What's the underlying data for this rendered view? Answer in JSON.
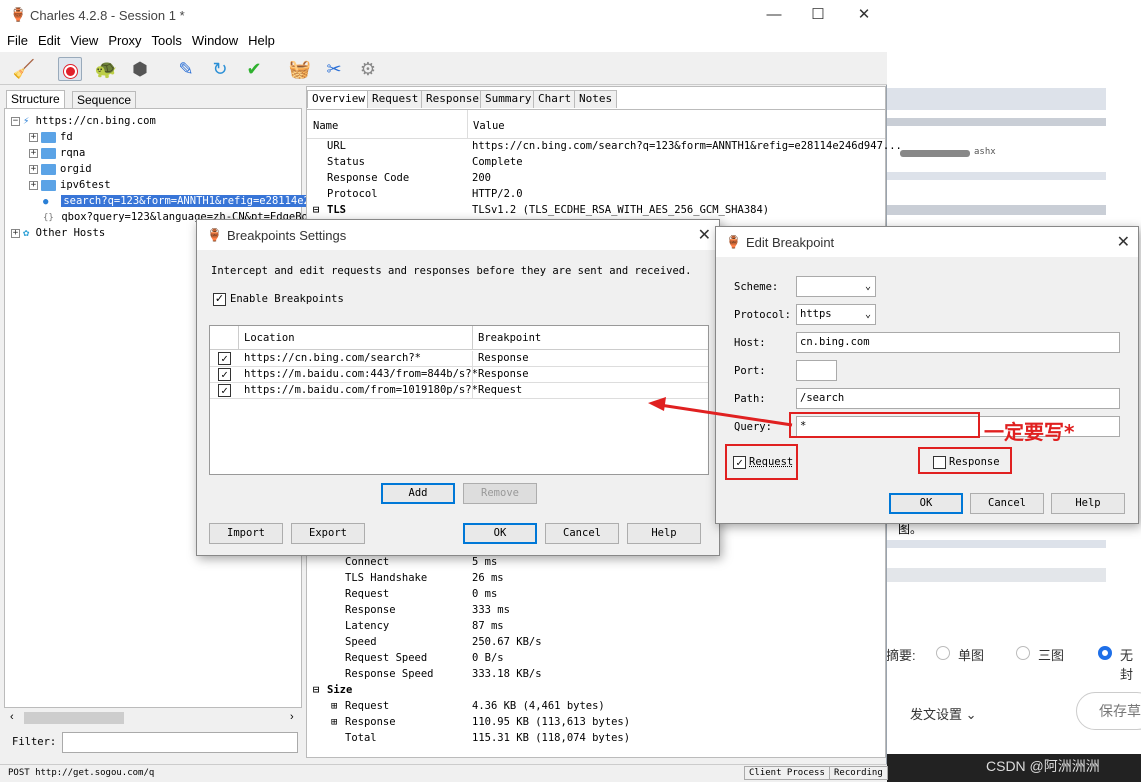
{
  "app": {
    "title": "Charles 4.2.8 - Session 1 *",
    "menu": [
      "File",
      "Edit",
      "View",
      "Proxy",
      "Tools",
      "Window",
      "Help"
    ],
    "toolbar_icons": [
      "broom-icon",
      "record-icon",
      "turtle-icon",
      "stop-icon",
      "pen-icon",
      "refresh-icon",
      "check-icon",
      "basket-icon",
      "tools-icon",
      "gear-icon"
    ]
  },
  "left": {
    "tabs": [
      "Structure",
      "Sequence"
    ],
    "host": "https://cn.bing.com",
    "children": [
      "fd",
      "rqna",
      "orgid",
      "ipv6test"
    ],
    "selected": "search?q=123&form=ANNTH1&refig=e28114e2",
    "child2": "qbox?query=123&language=zh-CN&pt=EdgeBox",
    "other": "Other Hosts",
    "filter_label": "Filter:"
  },
  "right": {
    "tabs": [
      "Overview",
      "Request",
      "Response",
      "Summary",
      "Chart",
      "Notes"
    ],
    "col_name": "Name",
    "col_value": "Value",
    "rows_top": [
      {
        "n": "URL",
        "v": "https://cn.bing.com/search?q=123&form=ANNTH1&refig=e28114e246d947..."
      },
      {
        "n": "Status",
        "v": "Complete"
      },
      {
        "n": "Response Code",
        "v": "200"
      },
      {
        "n": "Protocol",
        "v": "HTTP/2.0"
      },
      {
        "n": "TLS",
        "v": "TLSv1.2 (TLS_ECDHE_RSA_WITH_AES_256_GCM_SHA384)"
      }
    ],
    "rows_timing": [
      {
        "n": "Connect",
        "v": "5 ms"
      },
      {
        "n": "TLS Handshake",
        "v": "26 ms"
      },
      {
        "n": "Request",
        "v": "0 ms"
      },
      {
        "n": "Response",
        "v": "333 ms"
      },
      {
        "n": "Latency",
        "v": "87 ms"
      },
      {
        "n": "Speed",
        "v": "250.67 KB/s"
      },
      {
        "n": "Request Speed",
        "v": "0 B/s"
      },
      {
        "n": "Response Speed",
        "v": "333.18 KB/s"
      }
    ],
    "size_label": "Size",
    "rows_size": [
      {
        "n": "Request",
        "v": "4.36 KB (4,461 bytes)"
      },
      {
        "n": "Response",
        "v": "110.95 KB (113,613 bytes)"
      },
      {
        "n": "Total",
        "v": "115.31 KB (118,074 bytes)"
      }
    ]
  },
  "status": {
    "left": "POST http://get.sogou.com/q",
    "client_process": "Client Process",
    "recording": "Recording"
  },
  "bp_dialog": {
    "title": "Breakpoints Settings",
    "desc": "Intercept and edit requests and responses before they are sent and received.",
    "enable_label": "Enable Breakpoints",
    "col_location": "Location",
    "col_breakpoint": "Breakpoint",
    "rows": [
      {
        "loc": "https://cn.bing.com/search?*",
        "bp": "Response"
      },
      {
        "loc": "https://m.baidu.com:443/from=844b/s?*",
        "bp": "Response"
      },
      {
        "loc": "https://m.baidu.com/from=1019180p/s?*",
        "bp": "Request"
      }
    ],
    "add": "Add",
    "remove": "Remove",
    "import": "Import",
    "export": "Export",
    "ok": "OK",
    "cancel": "Cancel",
    "help": "Help"
  },
  "edit_dialog": {
    "title": "Edit Breakpoint",
    "scheme_label": "Scheme:",
    "scheme_value": "",
    "protocol_label": "Protocol:",
    "protocol_value": "https",
    "host_label": "Host:",
    "host_value": "cn.bing.com",
    "port_label": "Port:",
    "port_value": "",
    "path_label": "Path:",
    "path_value": "/search",
    "query_label": "Query:",
    "query_value": "*",
    "request_label": "Request",
    "response_label": "Response",
    "ok": "OK",
    "cancel": "Cancel",
    "help": "Help"
  },
  "annotation": {
    "text": "一定要写*",
    "color": "#e02020"
  },
  "background_page": {
    "summary_label": "摘要:",
    "opt1": "单图",
    "opt2": "三图",
    "opt3": "无封",
    "publish_settings": "发文设置",
    "save_button": "保存草",
    "watermark": "CSDN @阿洲洲洲",
    "snippet": "ashx",
    "fragment": "图。"
  }
}
